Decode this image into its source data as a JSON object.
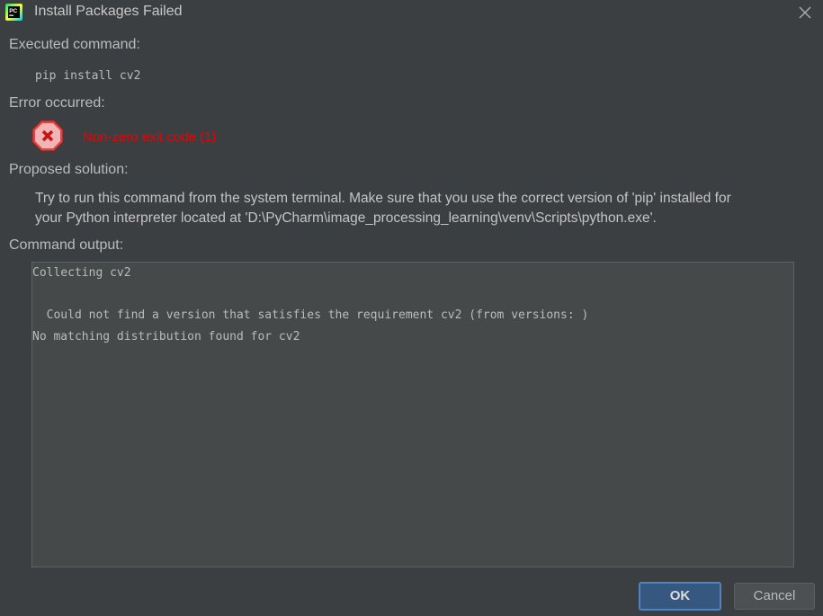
{
  "window": {
    "title": "Install Packages Failed"
  },
  "sections": {
    "executed_label": "Executed command:",
    "command": "pip install cv2",
    "error_label": "Error occurred:",
    "error_message": "Non-zero exit code (1)",
    "solution_label": "Proposed solution:",
    "solution_lines": [
      "Try to run this command from the system terminal. Make sure that you use the correct version of 'pip' installed for",
      "your Python interpreter located at 'D:\\PyCharm\\image_processing_learning\\venv\\Scripts\\python.exe'."
    ],
    "output_label": "Command output:"
  },
  "output": {
    "lines": [
      "Collecting cv2",
      "",
      "  Could not find a version that satisfies the requirement cv2 (from versions: )",
      "No matching distribution found for cv2"
    ]
  },
  "buttons": {
    "ok": "OK",
    "cancel": "Cancel"
  },
  "icons": {
    "app": "pycharm-icon",
    "close": "close-icon",
    "error": "error-icon"
  },
  "colors": {
    "background": "#3c3f41",
    "error_text": "#ee0000",
    "ok_button": "#365880"
  }
}
